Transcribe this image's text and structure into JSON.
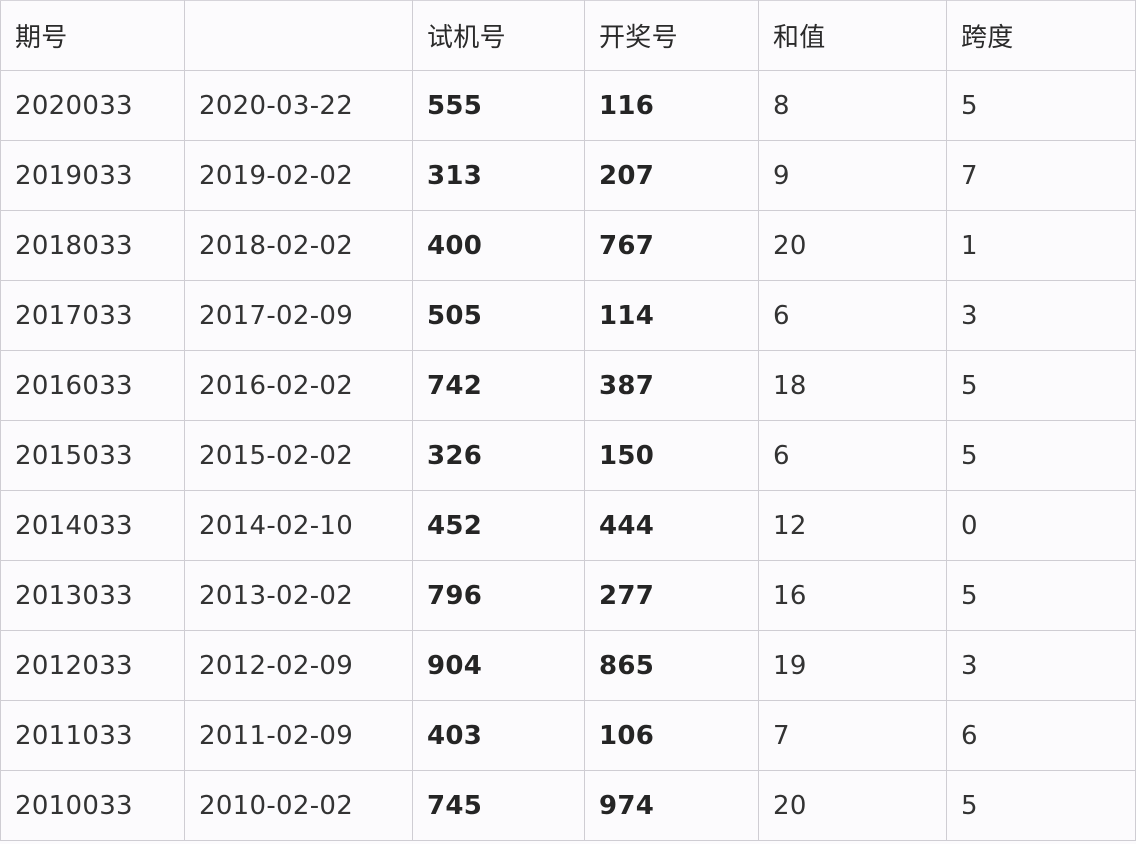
{
  "table": {
    "headers": [
      "期号",
      "",
      "试机号",
      "开奖号",
      "和值",
      "跨度"
    ],
    "rows": [
      {
        "issue": "2020033",
        "date": "2020-03-22",
        "test_number": "555",
        "draw_number": "116",
        "sum": "8",
        "span": "5"
      },
      {
        "issue": "2019033",
        "date": "2019-02-02",
        "test_number": "313",
        "draw_number": "207",
        "sum": "9",
        "span": "7"
      },
      {
        "issue": "2018033",
        "date": "2018-02-02",
        "test_number": "400",
        "draw_number": "767",
        "sum": "20",
        "span": "1"
      },
      {
        "issue": "2017033",
        "date": "2017-02-09",
        "test_number": "505",
        "draw_number": "114",
        "sum": "6",
        "span": "3"
      },
      {
        "issue": "2016033",
        "date": "2016-02-02",
        "test_number": "742",
        "draw_number": "387",
        "sum": "18",
        "span": "5"
      },
      {
        "issue": "2015033",
        "date": "2015-02-02",
        "test_number": "326",
        "draw_number": "150",
        "sum": "6",
        "span": "5"
      },
      {
        "issue": "2014033",
        "date": "2014-02-10",
        "test_number": "452",
        "draw_number": "444",
        "sum": "12",
        "span": "0"
      },
      {
        "issue": "2013033",
        "date": "2013-02-02",
        "test_number": "796",
        "draw_number": "277",
        "sum": "16",
        "span": "5"
      },
      {
        "issue": "2012033",
        "date": "2012-02-09",
        "test_number": "904",
        "draw_number": "865",
        "sum": "19",
        "span": "3"
      },
      {
        "issue": "2011033",
        "date": "2011-02-09",
        "test_number": "403",
        "draw_number": "106",
        "sum": "7",
        "span": "6"
      },
      {
        "issue": "2010033",
        "date": "2010-02-02",
        "test_number": "745",
        "draw_number": "974",
        "sum": "20",
        "span": "5"
      }
    ]
  }
}
